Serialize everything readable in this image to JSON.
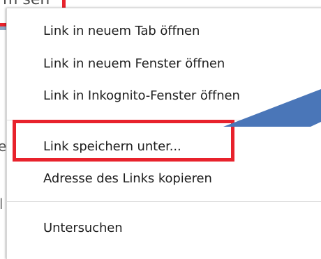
{
  "background": {
    "fragment_top": "m sen",
    "fragment_mid": "el",
    "fragment_low": "l"
  },
  "context_menu": {
    "items": [
      {
        "label": "Link in neuem Tab öffnen"
      },
      {
        "label": "Link in neuem Fenster öffnen"
      },
      {
        "label": "Link in Inkognito-Fenster öffnen"
      },
      {
        "label": "Link speichern unter..."
      },
      {
        "label": "Adresse des Links kopieren"
      },
      {
        "label": "Untersuchen"
      }
    ]
  },
  "annotations": {
    "highlight_color": "#e8222c",
    "callout_color": "#4a76b8",
    "highlighted_item": "Link speichern unter..."
  }
}
